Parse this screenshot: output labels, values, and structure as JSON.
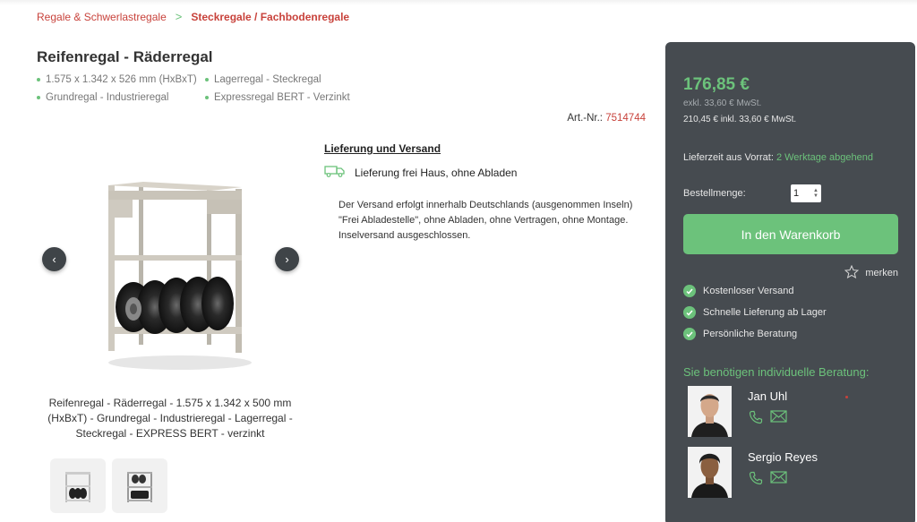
{
  "breadcrumb": {
    "parent": "Regale & Schwerlastregale",
    "separator": ">",
    "current": "Steckregale / Fachbodenregale"
  },
  "product": {
    "title": "Reifenregal - Räderregal",
    "features": [
      "1.575 x 1.342 x 526 mm (HxBxT)",
      "Lagerregal - Steckregal",
      "Grundregal - Industrieregal",
      "Expressregal BERT - Verzinkt"
    ],
    "art_nr_label": "Art.-Nr.:",
    "art_nr": "7514744",
    "caption": "Reifenregal - Räderregal - 1.575 x 1.342 x 500 mm (HxBxT) - Grundregal - Industrieregal - Lagerregal - Steckregal - EXPRESS BERT - verzinkt"
  },
  "gallery": {
    "prev_icon": "‹",
    "next_icon": "›"
  },
  "delivery": {
    "heading": "Lieferung und Versand",
    "line": "Lieferung frei Haus, ohne Abladen",
    "text": "Der Versand erfolgt innerhalb Deutschlands (ausgenommen Inseln) \"Frei Abladestelle\", ohne Abladen, ohne Vertragen, ohne Montage. Inselversand ausgeschlossen."
  },
  "sidebar": {
    "price": "176,85 €",
    "excl": "exkl. 33,60 € MwSt.",
    "incl": "210,45 € inkl. 33,60 € MwSt.",
    "lieferzeit_label": "Lieferzeit aus Vorrat:",
    "lieferzeit_value": "2 Werktage abgehend",
    "qty_label": "Bestellmenge:",
    "qty_value": "1",
    "cart_button": "In den Warenkorb",
    "merken": "merken",
    "benefits": [
      "Kostenloser Versand",
      "Schnelle Lieferung ab Lager",
      "Persönliche Beratung"
    ],
    "beratung_heading": "Sie benötigen individuelle Beratung:",
    "contacts": [
      {
        "name": "Jan Uhl"
      },
      {
        "name": "Sergio Reyes"
      }
    ]
  },
  "colors": {
    "accent_green": "#6cc27b",
    "accent_red": "#c8423b",
    "sidebar_bg": "#464b50"
  }
}
